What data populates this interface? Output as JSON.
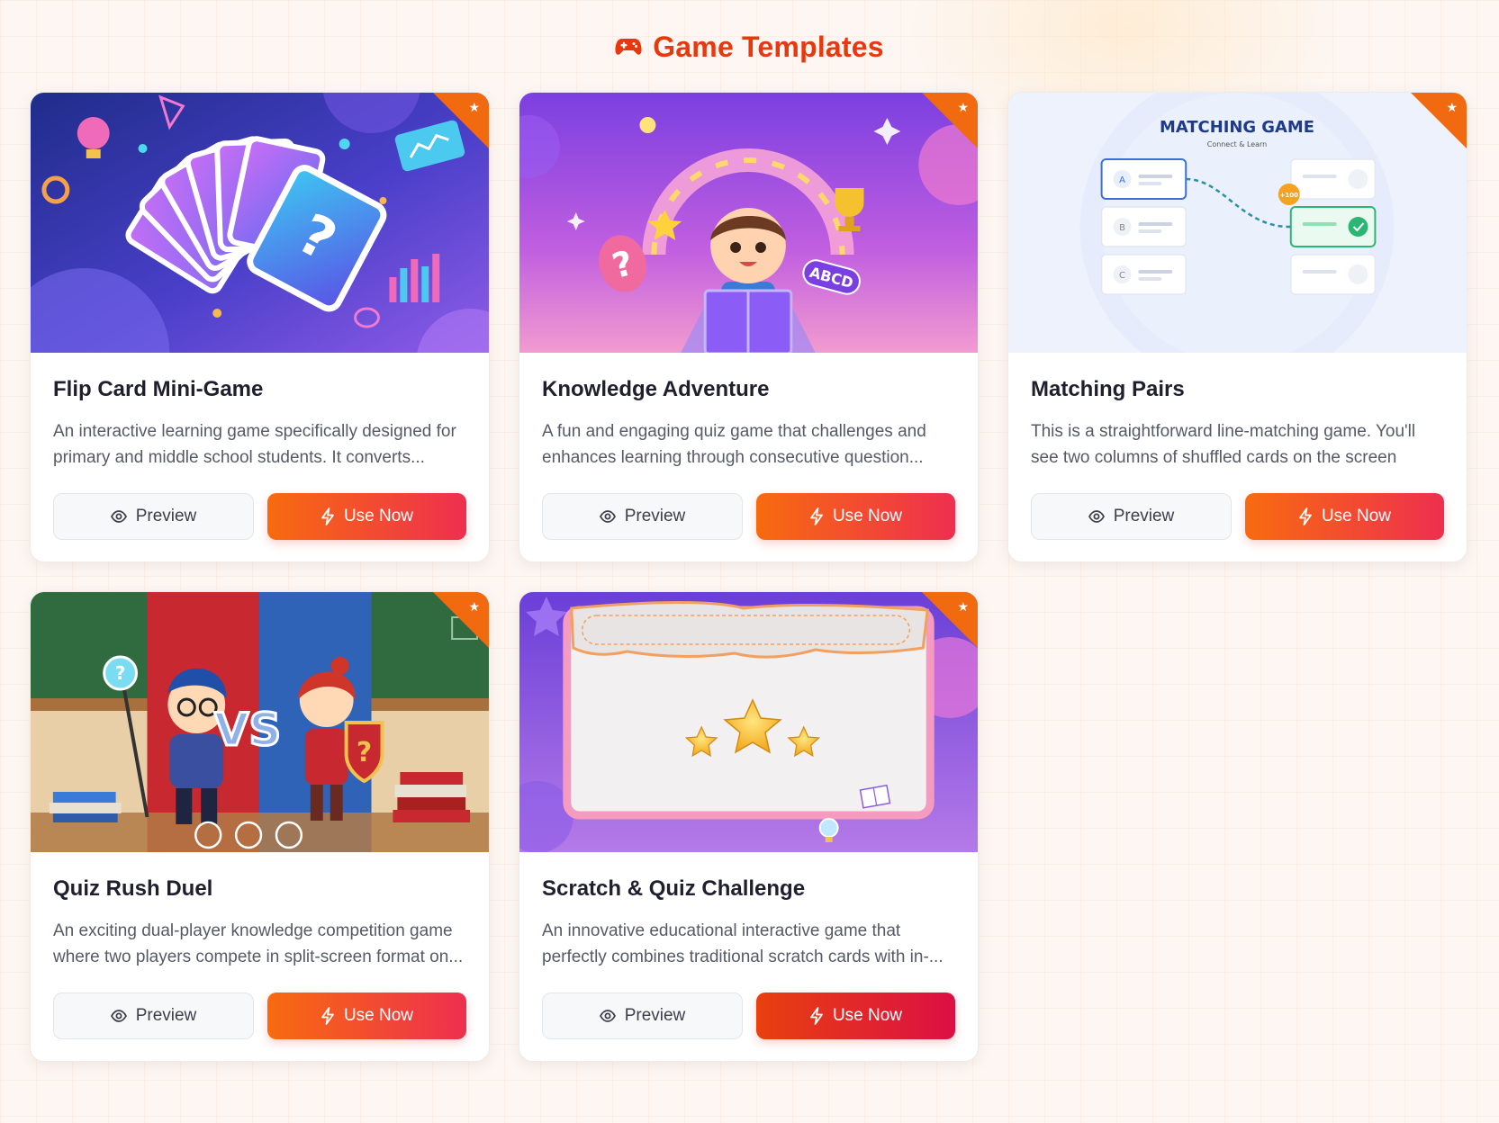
{
  "header": {
    "title": "Game Templates",
    "icon": "gamepad-icon"
  },
  "colors": {
    "accent": "#e8380d",
    "button_start": "#f76b0f",
    "button_end": "#ee2f4f",
    "badge": "#f26a10"
  },
  "cards": [
    {
      "title": "Flip Card Mini-Game",
      "description": "An interactive learning game specifically designed for primary and middle school students. It converts...",
      "preview_label": "Preview",
      "use_label": "Use Now",
      "badge": "★"
    },
    {
      "title": "Knowledge Adventure",
      "description": "A fun and engaging quiz game that challenges and enhances learning through consecutive question...",
      "preview_label": "Preview",
      "use_label": "Use Now",
      "badge": "★",
      "image_text": "ABCD"
    },
    {
      "title": "Matching Pairs",
      "description": "This is a straightforward line-matching game. You'll see two columns of shuffled cards on the screen with...",
      "preview_label": "Preview",
      "use_label": "Use Now",
      "badge": "★",
      "image_text": {
        "heading": "MATCHING GAME",
        "subheading": "Connect & Learn",
        "left_items": [
          "A",
          "B",
          "C"
        ],
        "score": "+100"
      }
    },
    {
      "title": "Quiz Rush Duel",
      "description": "An exciting dual-player knowledge competition game where two players compete in split-screen format on...",
      "preview_label": "Preview",
      "use_label": "Use Now",
      "badge": "★",
      "image_text": "VS"
    },
    {
      "title": "Scratch & Quiz Challenge",
      "description": "An innovative educational interactive game that perfectly combines traditional scratch cards with in-...",
      "preview_label": "Preview",
      "use_label": "Use Now",
      "badge": "★"
    }
  ]
}
